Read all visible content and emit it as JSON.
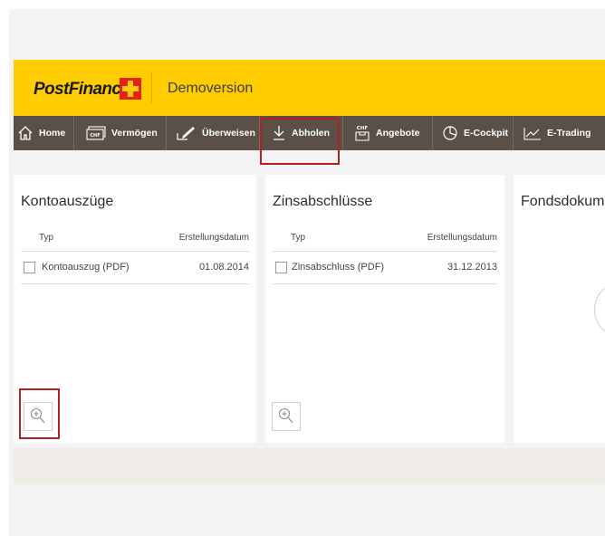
{
  "header": {
    "brand": "PostFinance",
    "mode": "Demoversion"
  },
  "nav": {
    "items": [
      {
        "label": "Home",
        "icon": "home-icon"
      },
      {
        "label": "Vermögen",
        "icon": "banknote-icon"
      },
      {
        "label": "Überweisen",
        "icon": "pen-transfer-icon"
      },
      {
        "label": "Abholen",
        "icon": "download-arrow-icon",
        "highlighted": true
      },
      {
        "label": "Angebote",
        "icon": "chf-offer-icon"
      },
      {
        "label": "E-Cockpit",
        "icon": "pie-chart-icon"
      },
      {
        "label": "E-Trading",
        "icon": "line-chart-icon"
      }
    ]
  },
  "panels": {
    "kontoauszuege": {
      "title": "Kontoauszüge",
      "col_type": "Typ",
      "col_date": "Erstellungsdatum",
      "rows": [
        {
          "type": "Kontoauszug (PDF)",
          "date": "01.08.2014"
        }
      ]
    },
    "zinsabschluesse": {
      "title": "Zinsabschlüsse",
      "col_type": "Typ",
      "col_date": "Erstellungsdatum",
      "rows": [
        {
          "type": "Zinsabschluss (PDF)",
          "date": "31.12.2013"
        }
      ]
    },
    "fonds": {
      "title": "Fondsdokum"
    }
  },
  "colors": {
    "brand_yellow": "#ffcc00",
    "nav_bg": "#5a5048",
    "highlight_red": "#b0201e"
  }
}
